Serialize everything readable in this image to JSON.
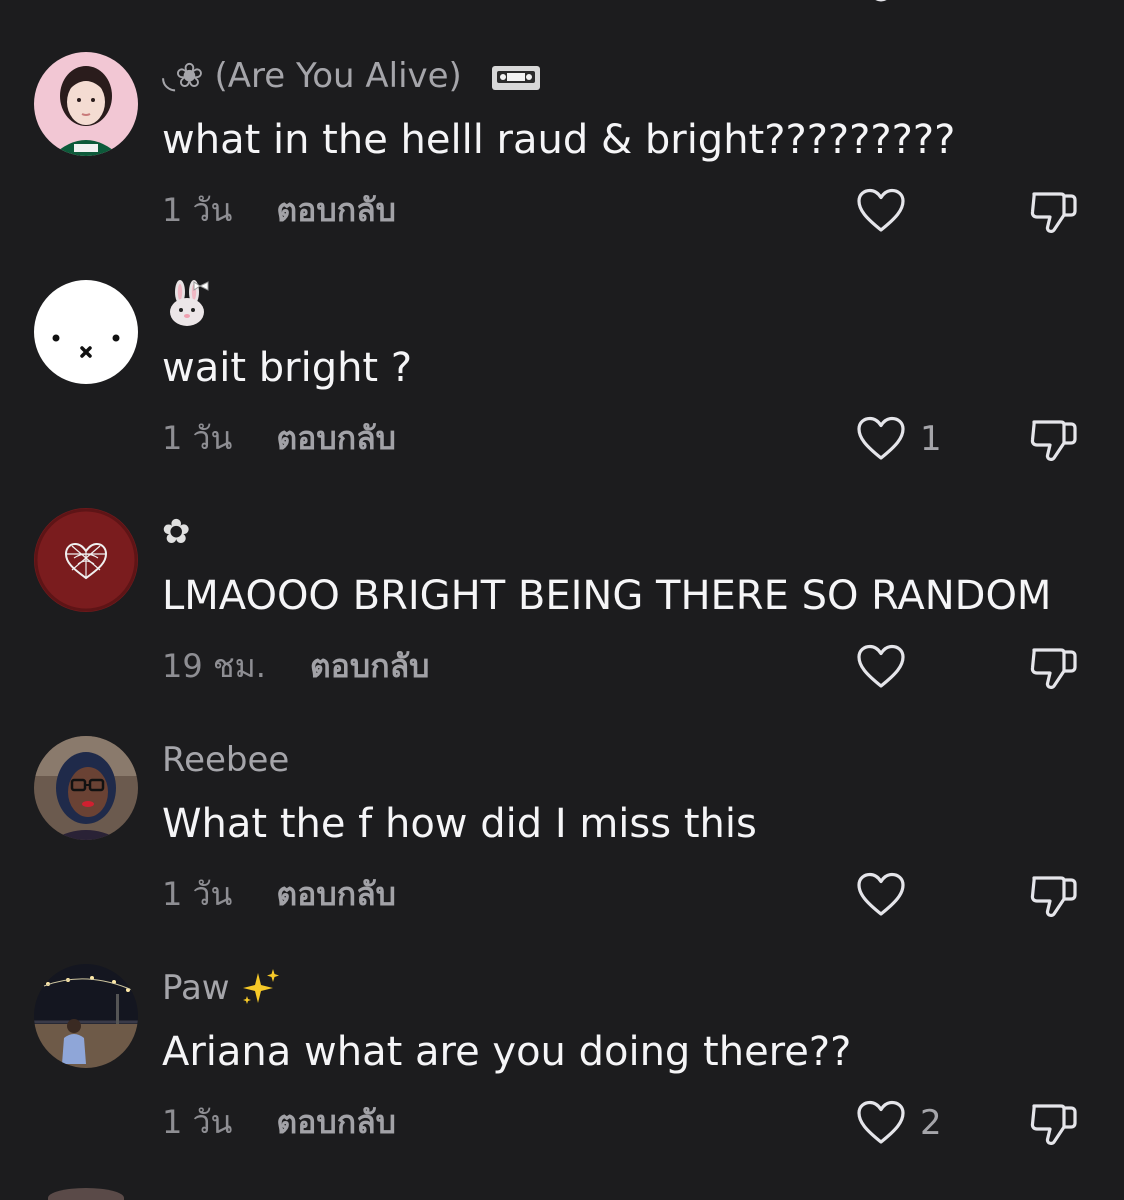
{
  "colors": {
    "background": "#1c1c1e",
    "username": "#a5a5aa",
    "body_text": "#f5f5f7",
    "meta_text": "#8e8e93"
  },
  "comments": [
    {
      "avatar_icon": "girl-photo-avatar",
      "username_prefix": "◟❀ ",
      "username": "(Are You Alive)",
      "username_suffix_icon": "vhs-tape-emoji",
      "text": "what in the helll raud & bright?????????",
      "time": "1 วัน",
      "reply_label": "ตอบกลับ",
      "like_count": ""
    },
    {
      "avatar_icon": "miffy-face-avatar",
      "username_prefix": "",
      "username": "",
      "username_suffix_icon": "bunny-bow-emoji",
      "text": "wait bright ?",
      "time": "1 วัน",
      "reply_label": "ตอบกลับ",
      "like_count": "1"
    },
    {
      "avatar_icon": "spiderweb-heart-avatar",
      "username_prefix": "",
      "username": "✿",
      "username_suffix_icon": "",
      "text": "LMAOOO BRIGHT BEING THERE SO RANDOM",
      "time": "19 ชม.",
      "reply_label": "ตอบกลับ",
      "like_count": ""
    },
    {
      "avatar_icon": "woman-glasses-avatar",
      "username_prefix": "",
      "username": "Reebee",
      "username_suffix_icon": "",
      "text": "What the f how did I miss this",
      "time": "1 วัน",
      "reply_label": "ตอบกลับ",
      "like_count": ""
    },
    {
      "avatar_icon": "night-photo-avatar",
      "username_prefix": "",
      "username": "Paw",
      "username_suffix_icon": "sparkles-emoji",
      "text": "Ariana what are you doing there??",
      "time": "1 วัน",
      "reply_label": "ตอบกลับ",
      "like_count": "2"
    }
  ]
}
